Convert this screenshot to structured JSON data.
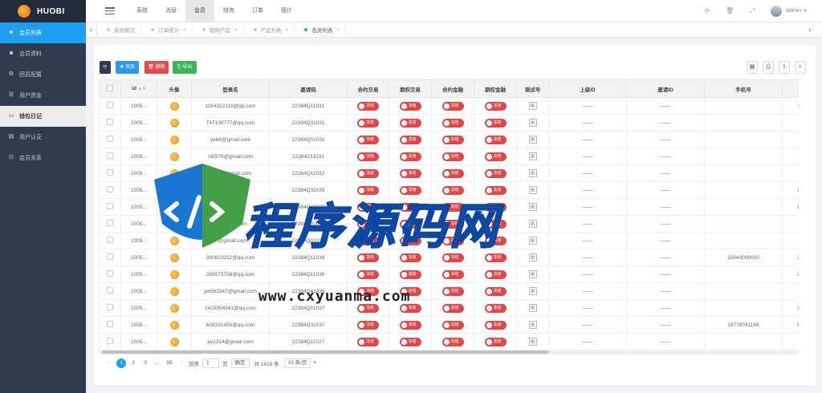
{
  "app": {
    "name": "HUOBI"
  },
  "sidebar": {
    "items": [
      {
        "label": "会员列表",
        "icon": "user-icon",
        "state": "active"
      },
      {
        "label": "会员资料",
        "icon": "user-icon",
        "state": ""
      },
      {
        "label": "团员配置",
        "icon": "gear-icon",
        "state": ""
      },
      {
        "label": "用户资金",
        "icon": "list-icon",
        "state": ""
      },
      {
        "label": "钱包日记",
        "icon": "card-icon",
        "state": "selected"
      },
      {
        "label": "用户认证",
        "icon": "id-card-icon",
        "state": ""
      },
      {
        "label": "会员关系",
        "icon": "group-icon",
        "state": ""
      }
    ]
  },
  "topnav": {
    "items": [
      "系统",
      "消息",
      "会员",
      "财务",
      "订单",
      "我计"
    ],
    "active_index": 2,
    "username": "admin"
  },
  "tabs": {
    "items": [
      {
        "label": "系统概况",
        "active": false,
        "closable": false
      },
      {
        "label": "订单统计",
        "active": false,
        "closable": true
      },
      {
        "label": "理财产品",
        "active": false,
        "closable": true
      },
      {
        "label": "产品列表",
        "active": false,
        "closable": true
      },
      {
        "label": "会员列表",
        "active": true,
        "closable": true
      }
    ]
  },
  "toolbar": {
    "refresh_icon": "refresh-icon",
    "add_label": "✚ 添加",
    "delete_label": "🗑 删除",
    "export_label": "⎘ 导出"
  },
  "table": {
    "headers": [
      "",
      "id",
      "头像",
      "登录名",
      "邀请码",
      "合约交易",
      "期权交易",
      "合约金融",
      "期权金融",
      "测试号",
      "上级ID",
      "邀请ID",
      "手机号",
      ""
    ],
    "toggle_label": "冻结",
    "dash": "——",
    "rows": [
      {
        "id": "1005...",
        "login": "1164312116@qq.com",
        "code": "22384Q11031",
        "phone": "",
        "last": "11043"
      },
      {
        "id": "1005...",
        "login": "747136777@qq.com",
        "code": "22384Q31031",
        "phone": "",
        "last": "7471"
      },
      {
        "id": "1005...",
        "login": "yeb6@gmail.com",
        "code": "22384Q01031",
        "phone": "",
        "last": ""
      },
      {
        "id": "1005...",
        "login": "ni5578@gmail.com",
        "code": "22384231031",
        "phone": "",
        "last": ""
      },
      {
        "id": "1005...",
        "login": "i0002@gmail.com",
        "code": "22384Q11032",
        "phone": "",
        "last": ""
      },
      {
        "id": "1005...",
        "login": "...563@qq.com",
        "code": "22384Q31039",
        "phone": "",
        "last": "10872"
      },
      {
        "id": "1005...",
        "login": "...@qq.com",
        "code": "22384Q41029",
        "phone": "",
        "last": "16176"
      },
      {
        "id": "1005...",
        "login": "...@gmail.com",
        "code": "22384Q01039",
        "phone": "",
        "last": ""
      },
      {
        "id": "1005...",
        "login": "...@gmail.com",
        "code": "22384Q01038",
        "phone": "",
        "last": ""
      },
      {
        "id": "1005...",
        "login": "390823312@qq.com",
        "code": "22384Q11038",
        "phone": "15643000000",
        "last": "39082"
      },
      {
        "id": "1005...",
        "login": "288573758@qq.com",
        "code": "22384Q11036",
        "phone": "",
        "last": "28857"
      },
      {
        "id": "1005...",
        "login": "yw563347@gmail.com",
        "code": "22384Q41036",
        "phone": "",
        "last": ""
      },
      {
        "id": "1005...",
        "login": "1415956541@qq.com",
        "code": "22384Q01037",
        "phone": "",
        "last": "14155"
      },
      {
        "id": "1005...",
        "login": "603331450@qq.com",
        "code": "22384Q31037",
        "phone": "18778761168",
        "last": "60333"
      },
      {
        "id": "1005...",
        "login": "ay1314@gmail.com",
        "code": "22384Q11027",
        "phone": "",
        "last": ""
      }
    ]
  },
  "pagination": {
    "current": "1",
    "pages": [
      "2",
      "3",
      "...",
      "95"
    ],
    "goto_label": "到第",
    "goto_value": "1",
    "page_unit": "页",
    "confirm_label": "确定",
    "total_label": "共 1418 条",
    "per_page": "15 条/页"
  },
  "watermark": {
    "title": "程序源码网",
    "url": "www.cxyuanma.com"
  },
  "colors": {
    "sidebar_bg": "#2f3a4c",
    "accent": "#1e9ff2",
    "danger": "#e24c4c",
    "success": "#3bb553"
  }
}
